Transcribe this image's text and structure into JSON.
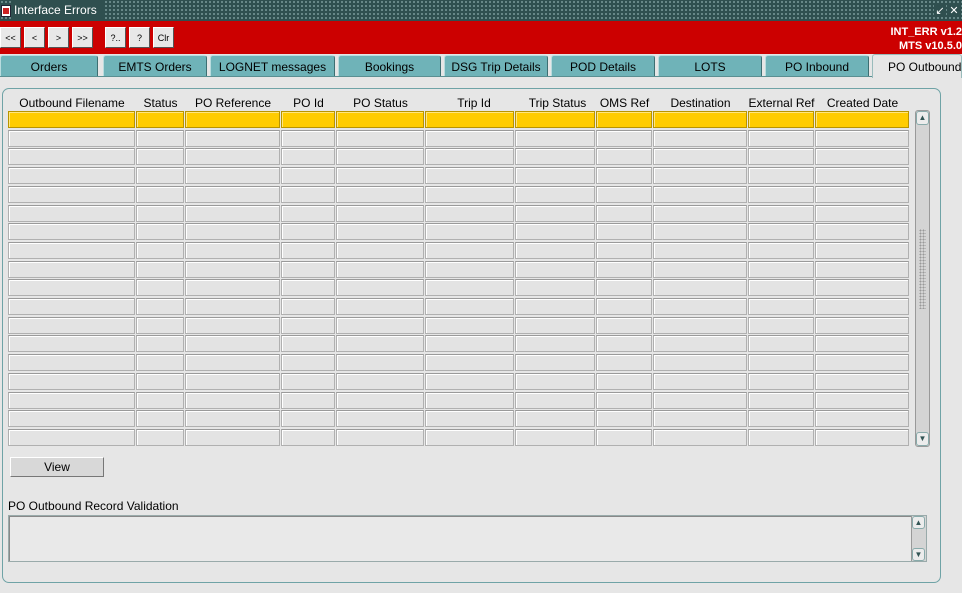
{
  "window": {
    "title": "Interface Errors",
    "minimize_glyph": "↙",
    "close_glyph": "✕"
  },
  "toolbar": {
    "buttons": [
      "<<",
      "<",
      ">",
      ">>",
      "?..",
      "?",
      "Clr"
    ],
    "version_line1": "INT_ERR v1.2",
    "version_line2": "MTS v10.5.0"
  },
  "tabs": [
    {
      "label": "Orders"
    },
    {
      "label": "EMTS Orders"
    },
    {
      "label": "LOGNET messages"
    },
    {
      "label": "Bookings"
    },
    {
      "label": "DSG Trip Details"
    },
    {
      "label": "POD Details"
    },
    {
      "label": "LOTS"
    },
    {
      "label": "PO Inbound"
    },
    {
      "label": "PO Outbound",
      "active": true
    }
  ],
  "table": {
    "columns": [
      "Outbound Filename",
      "Status",
      "PO Reference",
      "PO Id",
      "PO Status",
      "Trip Id",
      "Trip Status",
      "OMS Ref",
      "Destination",
      "External Ref",
      "Created Date"
    ],
    "row_count": 18,
    "selected_row": 0
  },
  "view_button": "View",
  "validation": {
    "label": "PO Outbound Record Validation",
    "value": ""
  },
  "colors": {
    "toolbar_bg": "#cc0000",
    "tab_bg": "#6fb3b8",
    "selected_row": "#ffcc00",
    "titlebar_bg": "#2f4f4f"
  },
  "icons": {
    "scroll_up": "▲",
    "scroll_down": "▼"
  }
}
